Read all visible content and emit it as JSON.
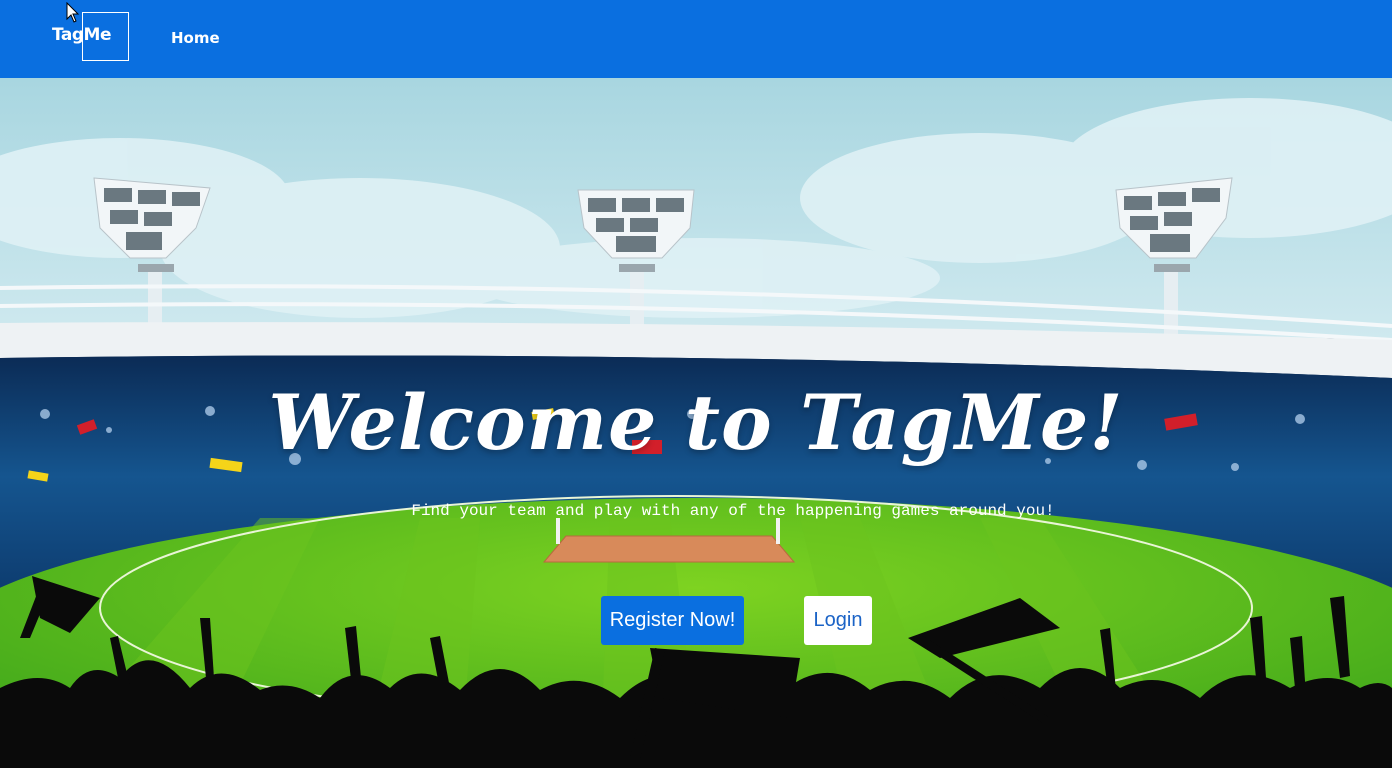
{
  "navbar": {
    "brand": "TagMe",
    "home_label": "Home",
    "color": "#0a6fe0"
  },
  "hero": {
    "title": "Welcome to TagMe!",
    "subtitle": "Find your team and play with any of the happening games around you!",
    "register_label": "Register Now!",
    "login_label": "Login",
    "background": "cricket-stadium-illustration"
  }
}
